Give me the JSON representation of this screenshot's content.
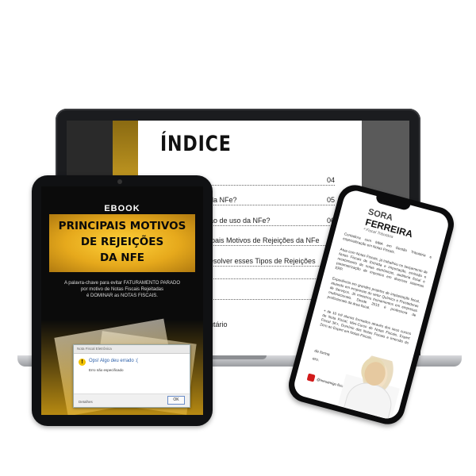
{
  "laptop": {
    "index_title": "ÍNDICE",
    "toc": [
      {
        "label": "",
        "page": "04"
      },
      {
        "label": "da NFe?",
        "page": "05"
      },
      {
        "label": "ão de uso da NFe?",
        "page": "06"
      },
      {
        "label": "ipais Motivos de Rejeições da NFe",
        "page": "..."
      },
      {
        "label": "esolver esses Tipos de Rejeições",
        "page": "......"
      },
      {
        "label": "",
        "page": ""
      },
      {
        "label": "",
        "page": ""
      },
      {
        "label": "utário",
        "page": ""
      }
    ]
  },
  "tablet": {
    "ebook_label": "EBOOK",
    "title_lines": [
      "PRINCIPAIS MOTIVOS",
      "DE REJEIÇÕES",
      "DA NFE"
    ],
    "subtitle_lines": [
      "A palavra-chave para evitar FATURAMENTO PARADO",
      "por motivo de Notas Fiscais Rejeitadas",
      "é DOMINAR as NOTAS FISCAIS."
    ],
    "dialog": {
      "title": "Nota Fiscal Eletrônica",
      "message": "Ops! Algo deu errado :(",
      "sub_message": "Erro não especificado",
      "details": "Detalhes",
      "ok": "OK"
    }
  },
  "phone": {
    "name_line1": "SORA",
    "name_line2": "FERREIRA",
    "role": "ª Fiscal Tributária",
    "paragraphs": [
      "Contadora com MBA em Gestão Tributária e especialização em Notas Fiscais.",
      "Atua com Notas Fiscais, já trabalhou no lançamento de Notas Fiscais de Entrada e importação, emissão e recebimento de notas eletrônicas, auditoria fiscal e parametrização de impostos em diversos sistemas ERP.",
      "Experiência em grandes projetos de implantação fiscal, atuando em empresas do setor Químico e Prestadoras de Serviços. Já ministrou treinamentos em empresas multinacionais. Desde 2015 é professora de profissionais da área fiscal.",
      "+ de 10 mil alunos formados através dos seus cursos de Nota Fiscal, Mini-Curso de Notas Fiscais, Expert Fiscal 3K+, Domínio das Notas Fiscais e Imersão do Zero ao Expert em Notas Fiscais."
    ],
    "signature": [
      "de forma",
      "ero."
    ],
    "handle": "@meuamigo fiscal"
  }
}
